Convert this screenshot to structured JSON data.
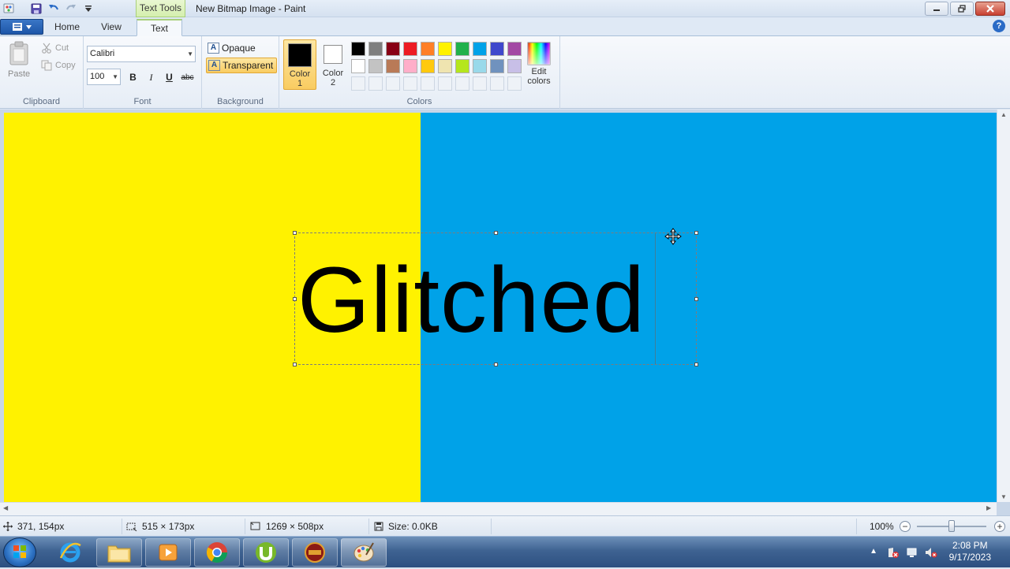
{
  "window": {
    "title": "New Bitmap Image - Paint",
    "context_tab": "Text Tools"
  },
  "tabs": {
    "home": "Home",
    "view": "View",
    "text": "Text"
  },
  "clipboard": {
    "paste": "Paste",
    "cut": "Cut",
    "copy": "Copy",
    "group_label": "Clipboard"
  },
  "font": {
    "family": "Calibri",
    "size": "100",
    "bold": "B",
    "italic": "I",
    "underline": "U",
    "strikethrough": "abc",
    "group_label": "Font"
  },
  "background": {
    "opaque": "Opaque",
    "transparent": "Transparent",
    "selected": "Transparent",
    "group_label": "Background"
  },
  "colors": {
    "color1_label": "Color 1",
    "color1_value": "#000000",
    "color2_label": "Color 2",
    "color2_value": "#ffffff",
    "edit_colors": "Edit colors",
    "group_label": "Colors",
    "palette_row1": [
      "#000000",
      "#7f7f7f",
      "#880015",
      "#ed1c24",
      "#ff7f27",
      "#fff200",
      "#22b14c",
      "#00a2e8",
      "#3f48cc",
      "#a349a4"
    ],
    "palette_row2": [
      "#ffffff",
      "#c3c3c3",
      "#b97a57",
      "#ffaec9",
      "#ffc90e",
      "#efe4b0",
      "#b5e61d",
      "#99d9ea",
      "#7092be",
      "#c8bfe7"
    ]
  },
  "canvas": {
    "text": "Glitched",
    "left_color": "#fff200",
    "right_color": "#00a2e8"
  },
  "status": {
    "cursor_pos": "371, 154px",
    "selection_size": "515 × 173px",
    "image_size": "1269 × 508px",
    "file_size": "Size: 0.0KB",
    "zoom": "100%"
  },
  "taskbar": {
    "time": "2:08 PM",
    "date": "9/17/2023",
    "apps": [
      "internet-explorer",
      "file-explorer",
      "media-player",
      "chrome",
      "utorrent",
      "game",
      "paint"
    ]
  }
}
